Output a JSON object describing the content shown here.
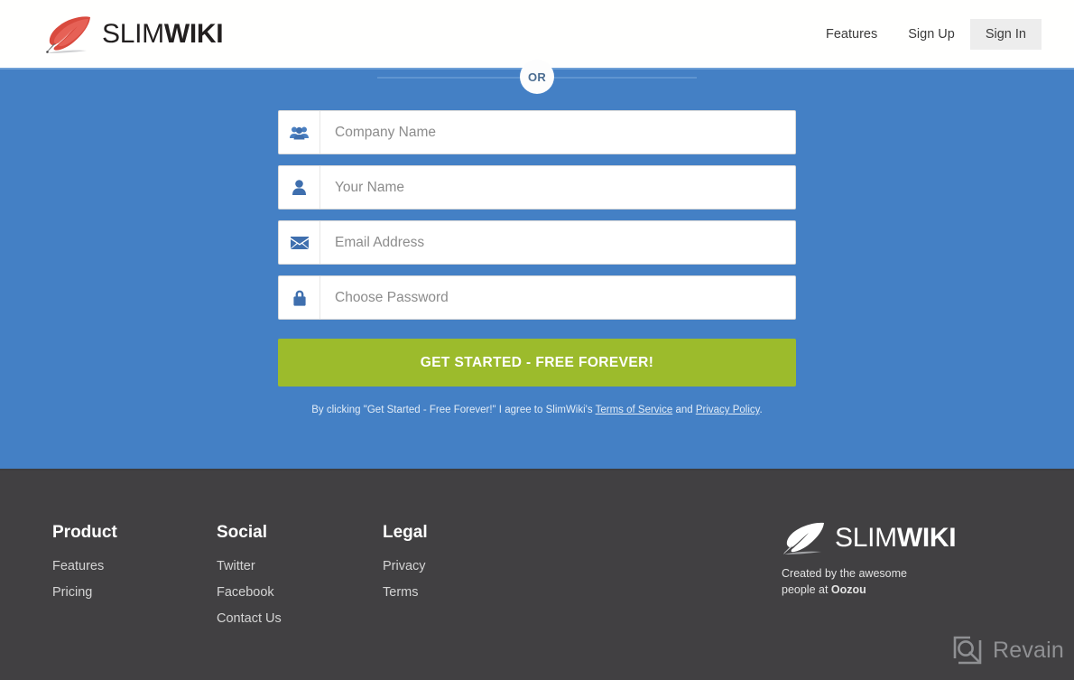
{
  "header": {
    "logo": {
      "icon": "feather-quill-icon",
      "text_light": "SLIM",
      "text_bold": "WIKI"
    },
    "nav": [
      {
        "label": "Features",
        "active": false
      },
      {
        "label": "Sign Up",
        "active": false
      },
      {
        "label": "Sign In",
        "active": true
      }
    ]
  },
  "signup": {
    "divider_label": "OR",
    "fields": [
      {
        "icon": "users-group-icon",
        "placeholder": "Company Name",
        "value": ""
      },
      {
        "icon": "user-icon",
        "placeholder": "Your Name",
        "value": ""
      },
      {
        "icon": "envelope-icon",
        "placeholder": "Email Address",
        "value": ""
      },
      {
        "icon": "lock-icon",
        "placeholder": "Choose Password",
        "value": ""
      }
    ],
    "cta_label": "GET STARTED - FREE FOREVER!",
    "terms": {
      "prefix": "By clicking \"Get Started - Free Forever!\" I agree to SlimWiki's ",
      "link1": "Terms of Service",
      "middle": " and ",
      "link2": "Privacy Policy",
      "suffix": "."
    },
    "background_color": "#4480c5",
    "cta_color": "#9cbb2c"
  },
  "footer": {
    "background_color": "#414042",
    "columns": [
      {
        "title": "Product",
        "links": [
          "Features",
          "Pricing"
        ]
      },
      {
        "title": "Social",
        "links": [
          "Twitter",
          "Facebook",
          "Contact Us"
        ]
      },
      {
        "title": "Legal",
        "links": [
          "Privacy",
          "Terms"
        ]
      }
    ],
    "brand": {
      "text_light": "SLIM",
      "text_bold": "WIKI",
      "credit_line1": "Created by the awesome",
      "credit_line2_prefix": "people at ",
      "credit_line2_bold": "Oozou"
    }
  },
  "watermark": {
    "icon": "revain-logo-icon",
    "label": "Revain"
  }
}
